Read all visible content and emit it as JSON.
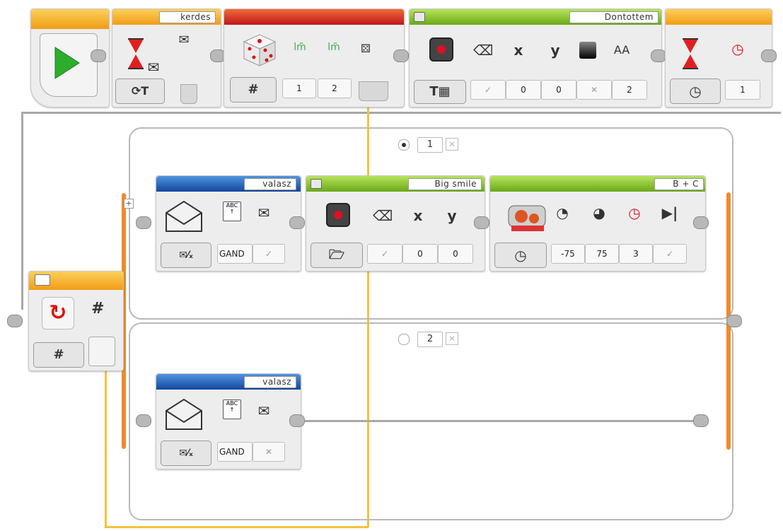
{
  "colors": {
    "orange": "#f29c16",
    "red": "#c0161a",
    "green": "#6aa819",
    "blue": "#13479c",
    "wire_yellow": "#f6c23a",
    "play_green": "#2cae2c"
  },
  "top_row": {
    "start_block": {
      "icon": "play-icon"
    },
    "wait_block": {
      "name": "kerdes",
      "mode_icon": "message-update-icon",
      "mode_label": "T"
    },
    "random_block": {
      "mode_label": "#",
      "params": [
        "1",
        "2"
      ]
    },
    "display_block": {
      "name": "Dontottem",
      "mode_label": "T",
      "axis_x": "x",
      "axis_y": "y",
      "font_icon": "AA",
      "params": [
        "0",
        "0",
        "2"
      ]
    },
    "wait_timer_block": {
      "params": [
        "1"
      ]
    }
  },
  "switch": {
    "mode_label": "#",
    "header_label": "#",
    "case1": {
      "label": "1"
    },
    "case2": {
      "label": "2"
    }
  },
  "case1_blocks": {
    "receive": {
      "name": "valasz",
      "param": "GAND"
    },
    "display": {
      "name": "Big smile",
      "axis_x": "x",
      "axis_y": "y",
      "params": [
        "0",
        "0"
      ]
    },
    "motor": {
      "name": "B + C",
      "params": [
        "-75",
        "75",
        "3"
      ]
    }
  },
  "case2_blocks": {
    "receive": {
      "name": "valasz",
      "param": "GAND"
    }
  }
}
